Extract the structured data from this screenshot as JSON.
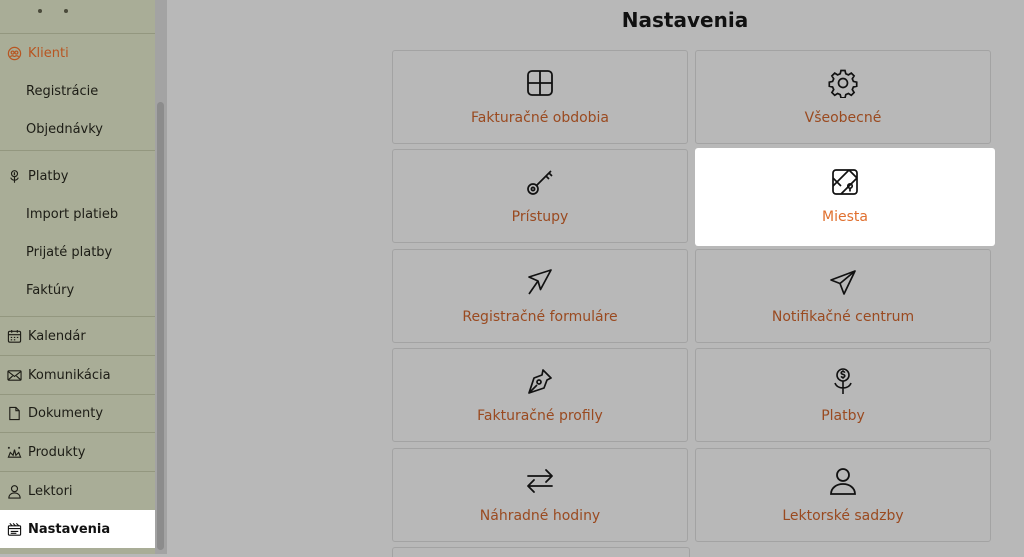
{
  "sidebar": {
    "items": [
      {
        "label": "Klienti",
        "icon": "users-icon"
      },
      {
        "label": "Registrácie"
      },
      {
        "label": "Objednávky"
      },
      {
        "label": "Platby",
        "icon": "money-plant-icon"
      },
      {
        "label": "Import platieb"
      },
      {
        "label": "Prijaté platby"
      },
      {
        "label": "Faktúry"
      },
      {
        "label": "Kalendár",
        "icon": "calendar-icon"
      },
      {
        "label": "Komunikácia",
        "icon": "mail-icon"
      },
      {
        "label": "Dokumenty",
        "icon": "document-icon"
      },
      {
        "label": "Produkty",
        "icon": "products-icon"
      },
      {
        "label": "Lektori",
        "icon": "user-icon"
      }
    ],
    "active": {
      "label": "Nastavenia",
      "icon": "settings-board-icon"
    }
  },
  "page": {
    "title": "Nastavenia"
  },
  "cards": [
    {
      "label": "Fakturačné obdobia",
      "icon": "grid-icon"
    },
    {
      "label": "Všeobecné",
      "icon": "gear-icon"
    },
    {
      "label": "Prístupy",
      "icon": "key-icon"
    },
    {
      "label": "Miesta",
      "icon": "map-icon"
    },
    {
      "label": "Registračné formuláre",
      "icon": "cursor-arrow-icon"
    },
    {
      "label": "Notifikačné centrum",
      "icon": "paper-plane-icon"
    },
    {
      "label": "Fakturačné profily",
      "icon": "pen-nib-icon"
    },
    {
      "label": "Platby",
      "icon": "money-plant-icon"
    },
    {
      "label": "Náhradné hodiny",
      "icon": "swap-arrows-icon"
    },
    {
      "label": "Lektorské sadzby",
      "icon": "person-icon"
    }
  ],
  "colors": {
    "accent": "#e0702f",
    "sidebar_bg": "#a9ad97",
    "overlay_bg": "#b8b8b8"
  }
}
